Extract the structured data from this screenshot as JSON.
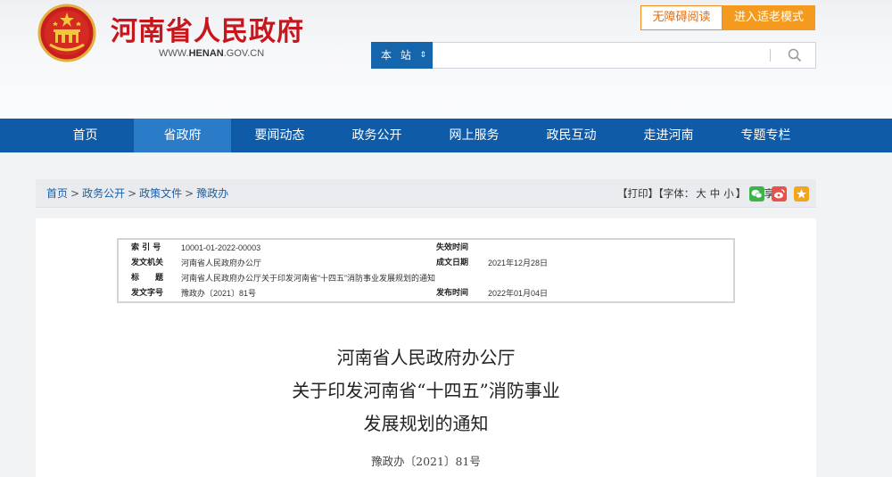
{
  "header": {
    "site_title": "河南省人民政府",
    "site_url_prefix": "WWW.",
    "site_url_brand": "HENAN",
    "site_url_suffix": ".GOV.CN",
    "accessibility_label": "无障碍阅读",
    "elder_mode_label": "进入适老模式",
    "brand_color": "#c8161d"
  },
  "search": {
    "scope_label": "本 站",
    "placeholder": ""
  },
  "nav": {
    "items": [
      "首页",
      "省政府",
      "要闻动态",
      "政务公开",
      "网上服务",
      "政民互动",
      "走进河南",
      "专题专栏"
    ],
    "active": "省政府",
    "color": "#0f5ba8"
  },
  "breadcrumb": {
    "items": [
      "首页",
      "政务公开",
      "政策文件",
      "豫政办"
    ],
    "separator": ">"
  },
  "tools": {
    "print_label": "【打印】",
    "font_label": "【字体：",
    "font_large": "大",
    "font_medium": "中",
    "font_small": "小",
    "font_close": "】",
    "share_label": "分享："
  },
  "meta": {
    "index_label": "索 引 号",
    "index_value": "10001-01-2022-00003",
    "expire_label": "失效时间",
    "expire_value": "",
    "issuer_label": "发文机关",
    "issuer_value": "河南省人民政府办公厅",
    "created_label": "成文日期",
    "created_value": "2021年12月28日",
    "title_label": "标　　题",
    "title_value": "河南省人民政府办公厅关于印发河南省“十四五”消防事业发展规划的通知",
    "docno_label": "发文字号",
    "docno_value": "豫政办〔2021〕81号",
    "published_label": "发布时间",
    "published_value": "2022年01月04日"
  },
  "document": {
    "title_line1": "河南省人民政府办公厅",
    "title_line2": "关于印发河南省“十四五”消防事业",
    "title_line3": "发展规划的通知",
    "number": "豫政办〔2021〕81号"
  }
}
